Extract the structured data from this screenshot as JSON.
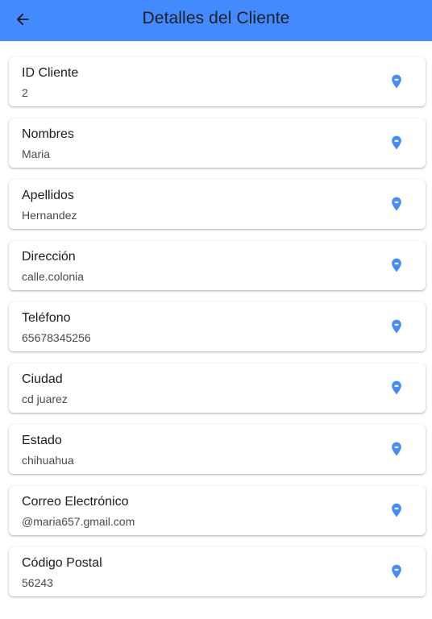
{
  "header": {
    "title": "Detalles del Cliente",
    "back_icon": "arrow-back-icon",
    "background": "#448aff"
  },
  "fields": [
    {
      "label": "ID Cliente",
      "value": "2",
      "icon": "location-pin-icon"
    },
    {
      "label": "Nombres",
      "value": "Maria",
      "icon": "location-pin-icon"
    },
    {
      "label": "Apellidos",
      "value": "Hernandez",
      "icon": "location-pin-icon"
    },
    {
      "label": "Dirección",
      "value": "calle.colonia",
      "icon": "location-pin-icon"
    },
    {
      "label": "Teléfono",
      "value": "65678345256",
      "icon": "location-pin-icon"
    },
    {
      "label": "Ciudad",
      "value": "cd juarez",
      "icon": "location-pin-icon"
    },
    {
      "label": "Estado",
      "value": "chihuahua",
      "icon": "location-pin-icon"
    },
    {
      "label": "Correo Electrónico",
      "value": "@maria657.gmail.com",
      "icon": "location-pin-icon"
    },
    {
      "label": "Código Postal",
      "value": "56243",
      "icon": "location-pin-icon"
    }
  ],
  "colors": {
    "icon": "#448aff",
    "card": "#ffffff"
  }
}
